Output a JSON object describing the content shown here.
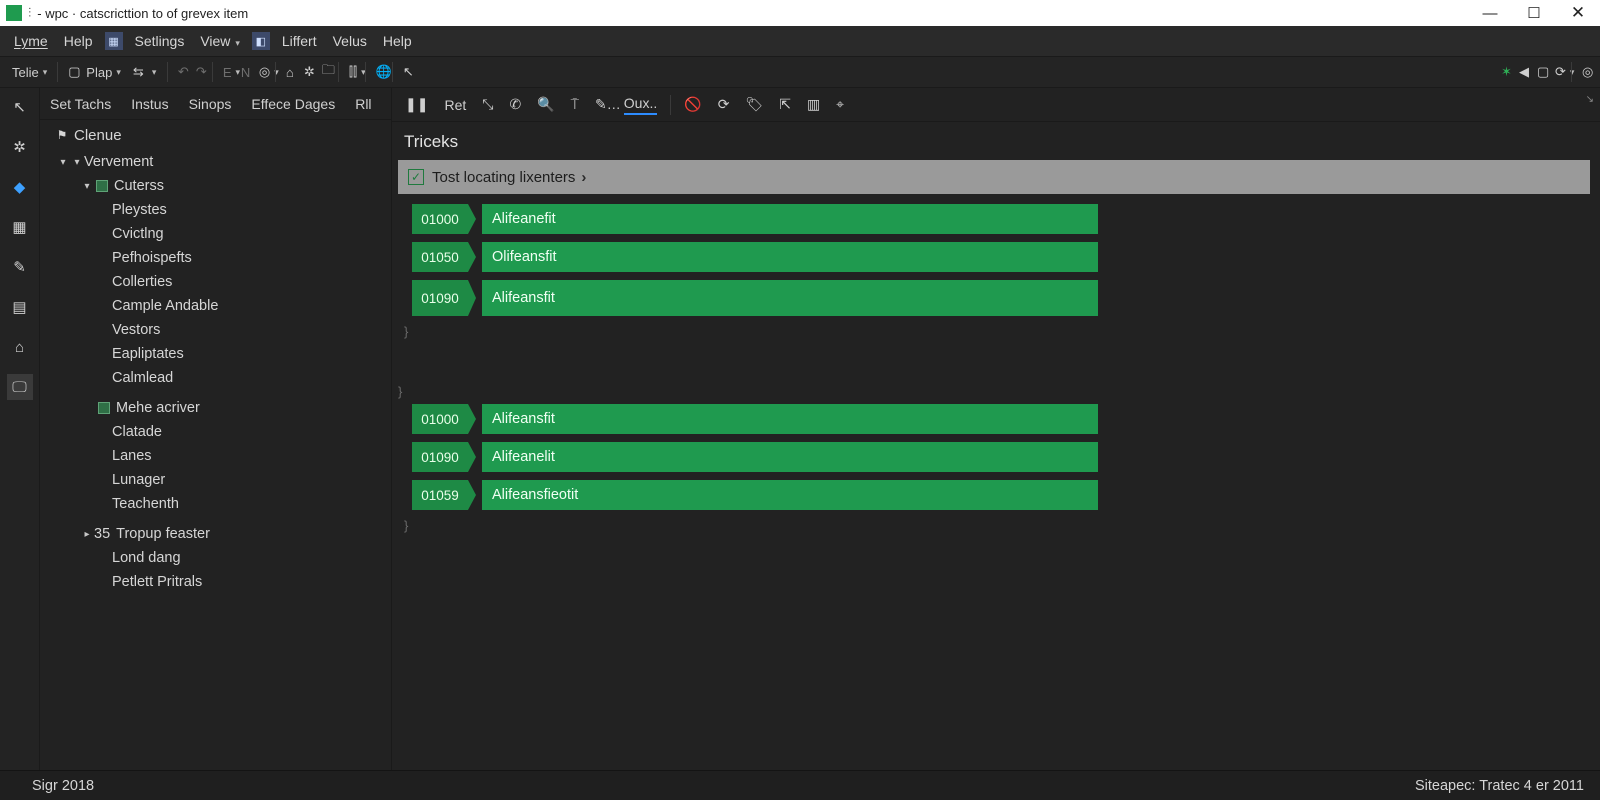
{
  "window": {
    "title_prefix": "⫶",
    "title": "- wpc · catscricttion to of grevex item"
  },
  "menubar": {
    "items": [
      "Lyme",
      "Help",
      "Setlings",
      "View",
      "Liffert",
      "Velus",
      "Help"
    ]
  },
  "toolbar": {
    "dropdown1": "Telie",
    "dropdown2": "Plap"
  },
  "upper_tabs": [
    "Set Tachs",
    "Instus",
    "Sinops",
    "Effece Dages",
    "Rll"
  ],
  "tree": {
    "top_label": "Clenue",
    "root": "Vervement",
    "group1": {
      "label": "Cuterss",
      "items": [
        "Pleystes",
        "Cvictlng",
        "Pefhoispefts",
        "Collerties",
        "Cample Andable",
        "Vestors",
        "Eapliptates",
        "Calmlead"
      ]
    },
    "group2": {
      "label": "Mehe acriver",
      "items": [
        "Clatade",
        "Lanes",
        "Lunager",
        "Teachenth"
      ]
    },
    "group3": {
      "badge": "35",
      "label": "Tropup feaster",
      "items": [
        "Lond dang",
        "Petlett Pritrals"
      ]
    }
  },
  "content": {
    "tool_label": "Ret",
    "tool_link": "Oux..",
    "heading": "Triceks",
    "group_header": "Tost locating lixenters",
    "blocks_a": [
      {
        "id": "01000",
        "label": "Alifeanefit"
      },
      {
        "id": "01050",
        "label": "Olifeansfit"
      },
      {
        "id": "01090",
        "label": "Alifeansfit"
      }
    ],
    "blocks_b": [
      {
        "id": "01000",
        "label": "Alifeansfit"
      },
      {
        "id": "01090",
        "label": "Alifeanelit"
      },
      {
        "id": "01059",
        "label": "Alifeansfieotit"
      }
    ]
  },
  "status": {
    "left": "Sigr 2018",
    "right": "Siteapec: Tratec 4 er 2011"
  }
}
